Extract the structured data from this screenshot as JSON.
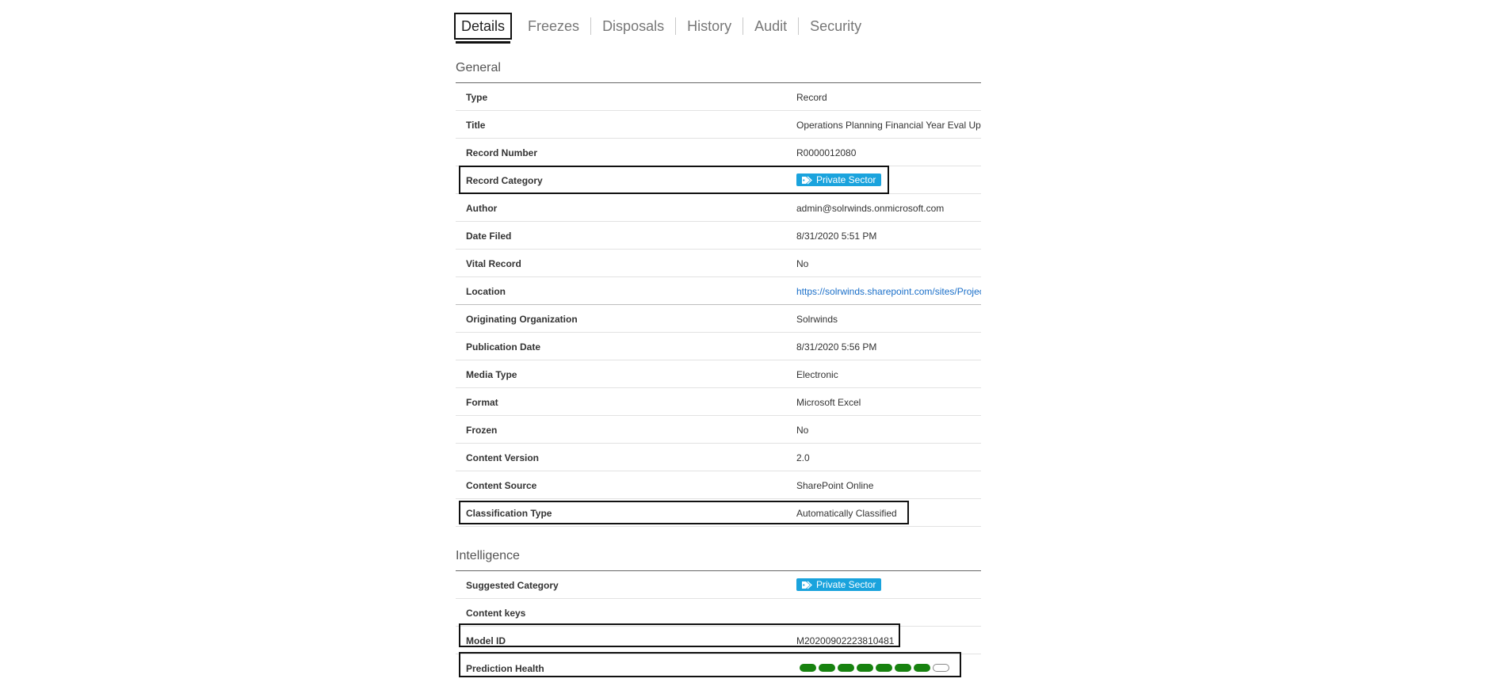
{
  "tabs": [
    {
      "label": "Details",
      "active": true
    },
    {
      "label": "Freezes",
      "active": false
    },
    {
      "label": "Disposals",
      "active": false
    },
    {
      "label": "History",
      "active": false
    },
    {
      "label": "Audit",
      "active": false
    },
    {
      "label": "Security",
      "active": false
    }
  ],
  "general": {
    "title": "General",
    "rows": [
      {
        "label": "Type",
        "value": "Record"
      },
      {
        "label": "Title",
        "value": "Operations Planning Financial Year Eval Up"
      },
      {
        "label": "Record Number",
        "value": "R0000012080"
      },
      {
        "label": "Record Category",
        "badge": "Private Sector"
      },
      {
        "label": "Author",
        "value": "admin@solrwinds.onmicrosoft.com"
      },
      {
        "label": "Date Filed",
        "value": "8/31/2020 5:51 PM"
      },
      {
        "label": "Vital Record",
        "value": "No"
      },
      {
        "label": "Location",
        "value": "https://solrwinds.sharepoint.com/sites/Projec"
      },
      {
        "label": "Originating Organization",
        "value": "Solrwinds"
      },
      {
        "label": "Publication Date",
        "value": "8/31/2020 5:56 PM"
      },
      {
        "label": "Media Type",
        "value": "Electronic"
      },
      {
        "label": "Format",
        "value": "Microsoft Excel"
      },
      {
        "label": "Frozen",
        "value": "No"
      },
      {
        "label": "Content Version",
        "value": "2.0"
      },
      {
        "label": "Content Source",
        "value": "SharePoint Online"
      },
      {
        "label": "Classification Type",
        "value": "Automatically Classified"
      }
    ]
  },
  "intelligence": {
    "title": "Intelligence",
    "rows": [
      {
        "label": "Suggested Category",
        "badge": "Private Sector"
      },
      {
        "label": "Content keys",
        "value": ""
      },
      {
        "label": "Model ID",
        "value": "M20200902223810481"
      },
      {
        "label": "Prediction Health",
        "health": {
          "filled": 7,
          "total": 8
        }
      }
    ]
  },
  "colors": {
    "badge": "#1aa3dd",
    "health_filled": "#17820f",
    "link": "#1a6fc9"
  },
  "icons": {
    "badge_icon": "tag-icon"
  }
}
